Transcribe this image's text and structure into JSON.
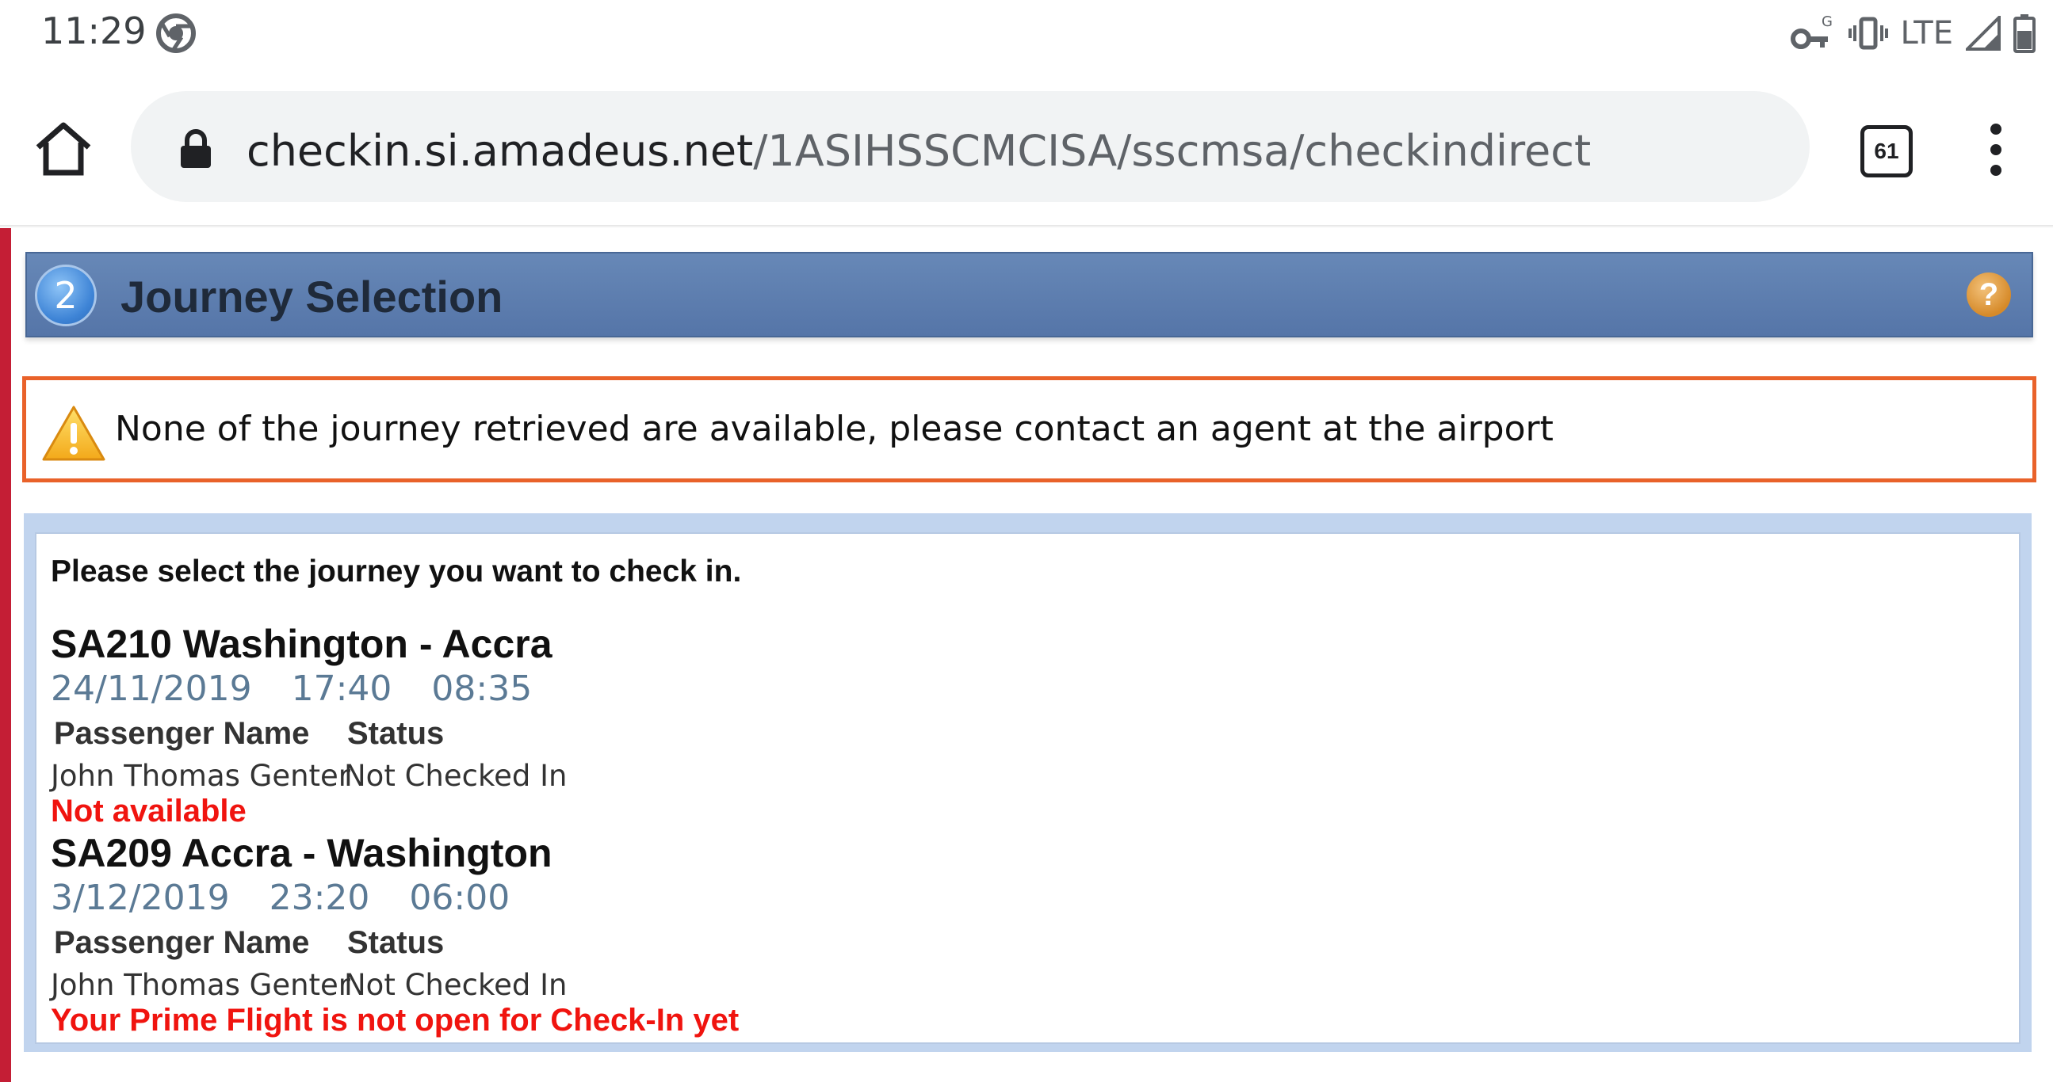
{
  "status_bar": {
    "time": "11:29",
    "network": "LTE",
    "icons": [
      "chrome-icon",
      "vpn-key-icon",
      "vibrate-icon",
      "signal-icon",
      "battery-icon"
    ]
  },
  "browser": {
    "url_host": "checkin.si.amadeus.net",
    "url_path": "/1ASIHSSCMCISA/sscmsa/checkindirect",
    "tab_count": "61"
  },
  "section": {
    "step_number": "2",
    "title": "Journey Selection",
    "help_label": "?"
  },
  "alert": {
    "message": "None of the journey retrieved are available, please contact an agent at the airport"
  },
  "journeys_panel": {
    "prompt": "Please select the journey you want to check in.",
    "journeys": [
      {
        "title": "SA210 Washington - Accra",
        "date": "24/11/2019",
        "departure": "17:40",
        "arrival": "08:35",
        "col_passenger": "Passenger Name",
        "col_status": "Status",
        "passenger_name": "John Thomas Genter",
        "passenger_status": "Not Checked In",
        "availability": "Not available"
      },
      {
        "title": "SA209 Accra - Washington",
        "date": "3/12/2019",
        "departure": "23:20",
        "arrival": "06:00",
        "col_passenger": "Passenger Name",
        "col_status": "Status",
        "passenger_name": "John Thomas Genter",
        "passenger_status": "Not Checked In",
        "availability": "Your Prime Flight is not open for Check-In yet"
      }
    ]
  },
  "colors": {
    "header_blue": "#5a7aab",
    "alert_border": "#e9622a",
    "error_red": "#f0140f",
    "meta_gray_blue": "#5b7a95",
    "accent_red": "#c41e35"
  }
}
